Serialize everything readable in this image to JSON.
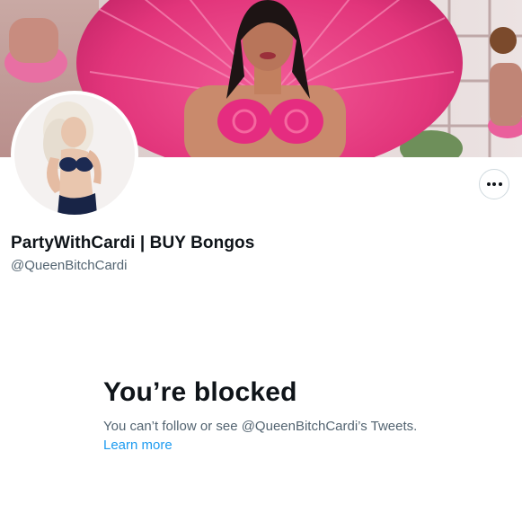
{
  "profile": {
    "banner_alt": "Profile banner",
    "avatar_alt": "Profile photo",
    "display_name": "PartyWithCardi | BUY Bongos",
    "handle": "@QueenBitchCardi",
    "more_button_icon": "more-horizontal-icon"
  },
  "blocked": {
    "title": "You’re blocked",
    "description": "You can’t follow or see @QueenBitchCardi’s Tweets.",
    "learn_more": "Learn more"
  },
  "colors": {
    "text_primary": "#0f1419",
    "text_secondary": "#536471",
    "link": "#1d9bf0",
    "border": "#cfd9de",
    "banner_pink": "#e0357a"
  }
}
